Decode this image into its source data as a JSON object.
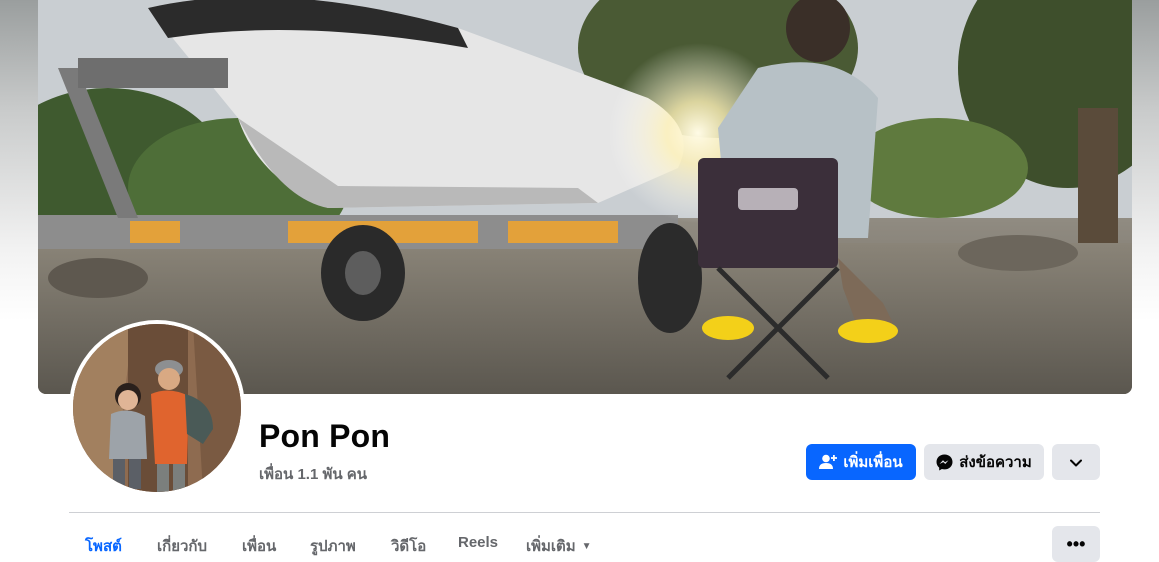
{
  "profile": {
    "name": "Pon Pon",
    "friends_count": "เพื่อน 1.1 พัน คน"
  },
  "actions": {
    "add_friend": "เพิ่มเพื่อน",
    "message": "ส่งข้อความ",
    "add_friend_icon": "person-add-icon",
    "message_icon": "messenger-icon",
    "dropdown_icon": "chevron-down-icon"
  },
  "tabs": [
    {
      "label": "โพสต์",
      "active": true
    },
    {
      "label": "เกี่ยวกับ",
      "active": false
    },
    {
      "label": "เพื่อน",
      "active": false
    },
    {
      "label": "รูปภาพ",
      "active": false
    },
    {
      "label": "วิดีโอ",
      "active": false
    },
    {
      "label": "Reels",
      "active": false
    },
    {
      "label": "เพิ่มเติม",
      "active": false,
      "icon": "caret-down-icon"
    }
  ],
  "tabs_overflow_label": "•••",
  "colors": {
    "accent": "#0866ff",
    "button_gray": "#e4e6eb",
    "text_primary": "#050505",
    "text_secondary": "#65676b",
    "divider": "#ced0d4"
  }
}
